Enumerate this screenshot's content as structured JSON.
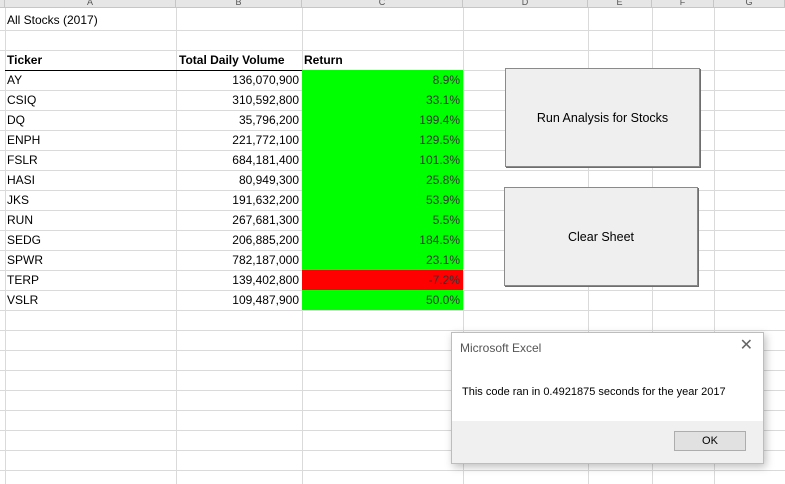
{
  "columns": [
    "A",
    "B",
    "C",
    "D",
    "E",
    "F",
    "G"
  ],
  "sheet_title": "All Stocks (2017)",
  "headers": {
    "ticker": "Ticker",
    "volume": "Total Daily Volume",
    "return": "Return"
  },
  "rows": [
    {
      "ticker": "AY",
      "volume": "136,070,900",
      "ret": "8.9%",
      "positive": true
    },
    {
      "ticker": "CSIQ",
      "volume": "310,592,800",
      "ret": "33.1%",
      "positive": true
    },
    {
      "ticker": "DQ",
      "volume": "35,796,200",
      "ret": "199.4%",
      "positive": true
    },
    {
      "ticker": "ENPH",
      "volume": "221,772,100",
      "ret": "129.5%",
      "positive": true
    },
    {
      "ticker": "FSLR",
      "volume": "684,181,400",
      "ret": "101.3%",
      "positive": true
    },
    {
      "ticker": "HASI",
      "volume": "80,949,300",
      "ret": "25.8%",
      "positive": true
    },
    {
      "ticker": "JKS",
      "volume": "191,632,200",
      "ret": "53.9%",
      "positive": true
    },
    {
      "ticker": "RUN",
      "volume": "267,681,300",
      "ret": "5.5%",
      "positive": true
    },
    {
      "ticker": "SEDG",
      "volume": "206,885,200",
      "ret": "184.5%",
      "positive": true
    },
    {
      "ticker": "SPWR",
      "volume": "782,187,000",
      "ret": "23.1%",
      "positive": true
    },
    {
      "ticker": "TERP",
      "volume": "139,402,800",
      "ret": "-7.2%",
      "positive": false
    },
    {
      "ticker": "VSLR",
      "volume": "109,487,900",
      "ret": "50.0%",
      "positive": true
    }
  ],
  "colors": {
    "positive": "#00ff00",
    "negative": "#ff0000"
  },
  "buttons": {
    "run": "Run Analysis for Stocks",
    "clear": "Clear Sheet"
  },
  "dialog": {
    "title": "Microsoft Excel",
    "close": "✕",
    "message": "This code ran in 0.4921875 seconds for the year 2017",
    "ok": "OK"
  }
}
